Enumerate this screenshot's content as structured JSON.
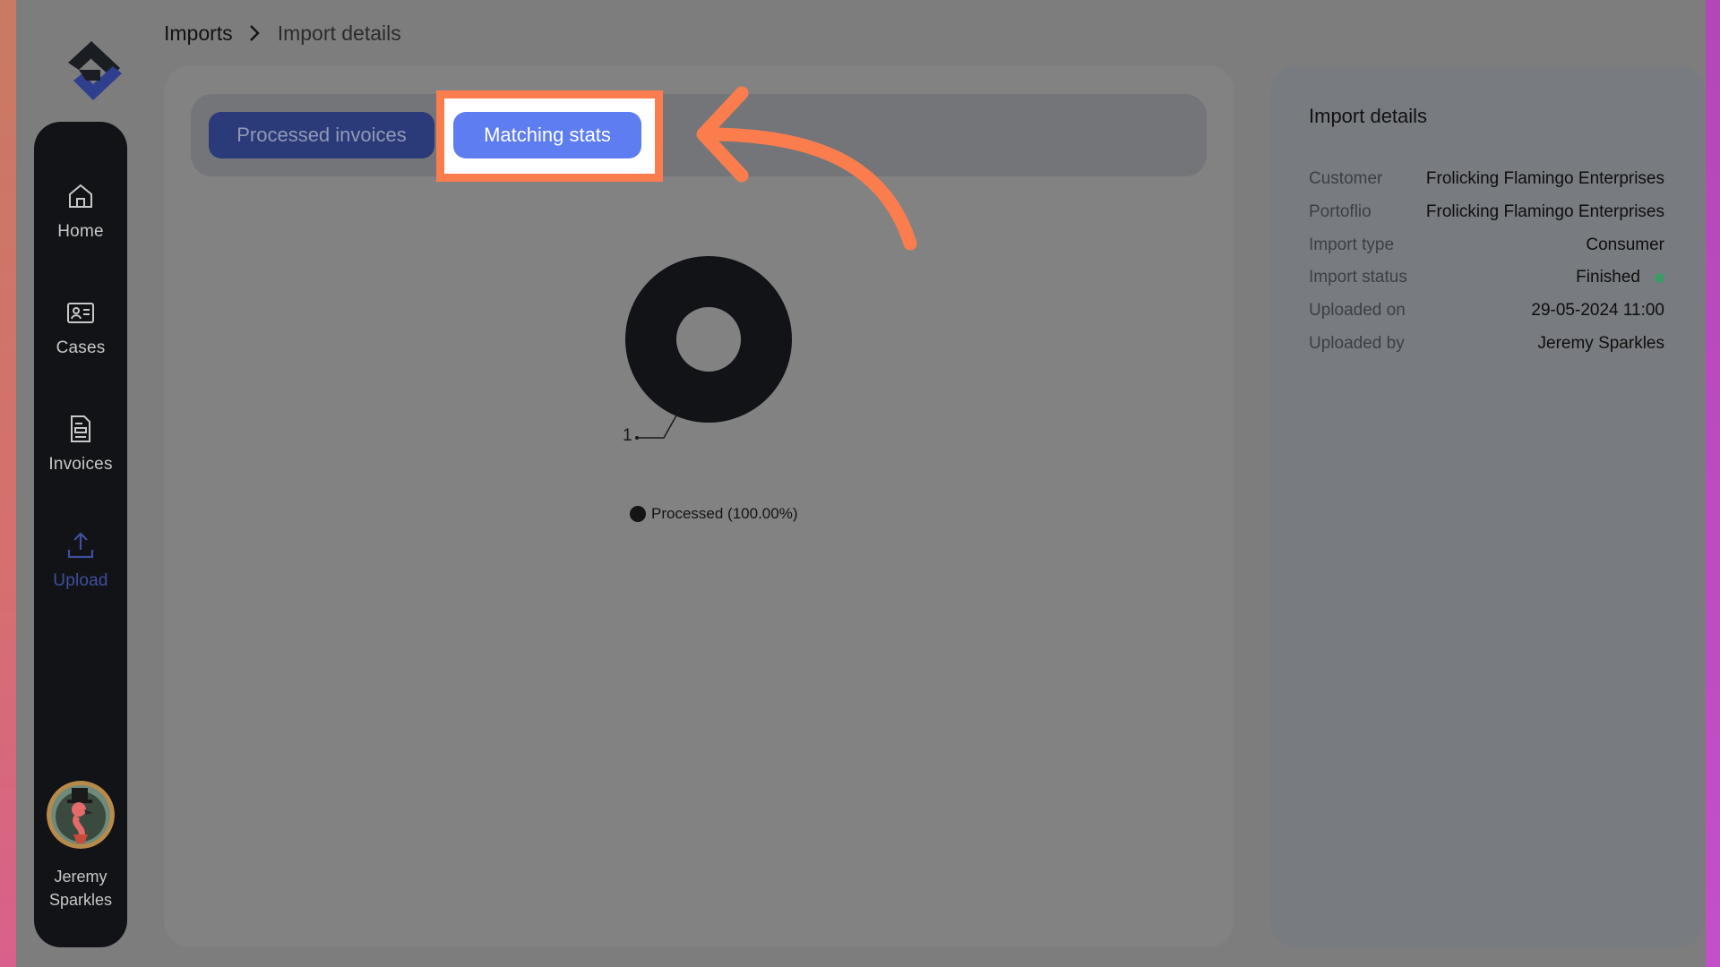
{
  "app": {
    "name": "Import details page"
  },
  "breadcrumb": {
    "root": "Imports",
    "current": "Import details"
  },
  "sidebar": {
    "items": [
      {
        "label": "Home",
        "icon": "home-icon"
      },
      {
        "label": "Cases",
        "icon": "id-card-icon"
      },
      {
        "label": "Invoices",
        "icon": "document-icon"
      },
      {
        "label": "Upload",
        "icon": "upload-icon",
        "active": true
      }
    ],
    "user": {
      "first_name": "Jeremy",
      "last_name": "Sparkles"
    }
  },
  "tabs": [
    {
      "label": "Processed invoices"
    },
    {
      "label": "Matching stats",
      "active": true
    }
  ],
  "chart_data": {
    "type": "pie",
    "variant": "donut",
    "slices": [
      {
        "label": "Processed",
        "value": 1,
        "percent": "100.00%"
      }
    ],
    "data_label": "1",
    "legend_label": "Processed (100.00%)",
    "legend_position": "bottom",
    "colors": [
      "#111316"
    ]
  },
  "details": {
    "title": "Import details",
    "rows": [
      {
        "label": "Customer",
        "value": "Frolicking Flamingo Enterprises"
      },
      {
        "label": "Portoflio",
        "value": "Frolicking Flamingo Enterprises"
      },
      {
        "label": "Import type",
        "value": "Consumer"
      },
      {
        "label": "Import status",
        "value": "Finished",
        "status_color": "#3f9a6a"
      },
      {
        "label": "Uploaded on",
        "value": "29-05-2024 11:00"
      },
      {
        "label": "Uploaded by",
        "value": "Jeremy Sparkles"
      }
    ]
  },
  "colors": {
    "annotation": "#fb7d4e",
    "active_tab": "#5d7df0",
    "inactive_tab": "#2b3a78",
    "sidebar": "#111316"
  }
}
